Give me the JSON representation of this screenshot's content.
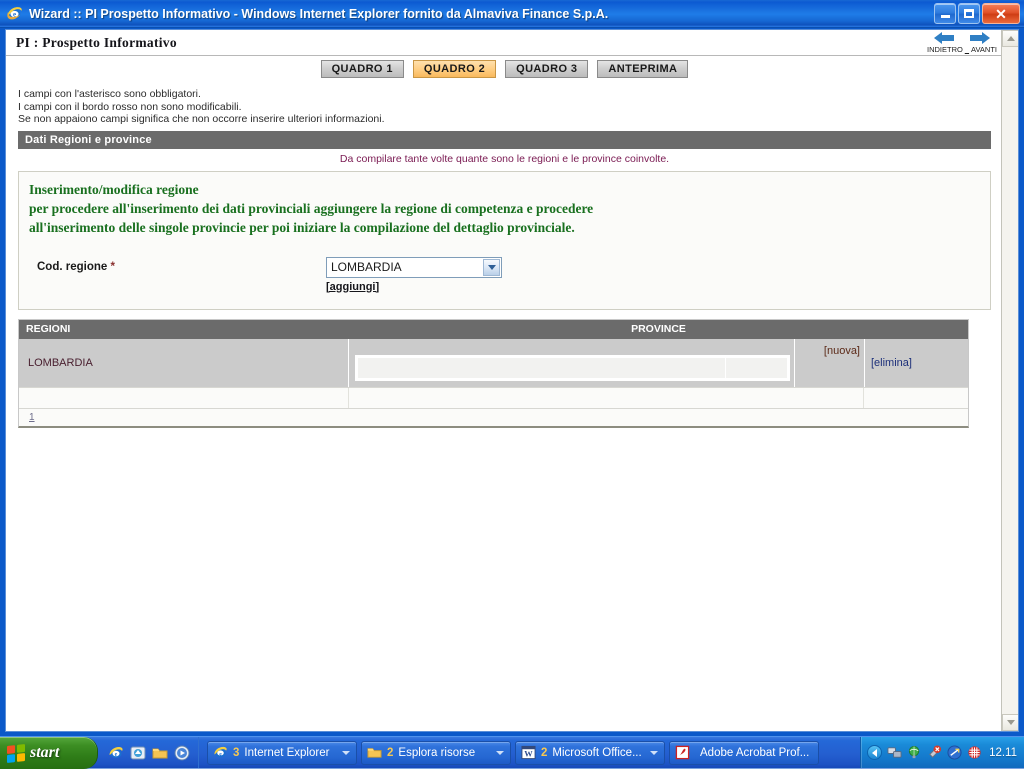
{
  "window": {
    "title": "Wizard :: PI Prospetto Informativo - Windows Internet Explorer fornito da Almaviva Finance S.p.A.",
    "icon": "ie-logo-icon",
    "minimize_label": "Minimize",
    "maximize_label": "Maximize",
    "close_label": "Close"
  },
  "page": {
    "title": "PI  :  Prospetto Informativo",
    "nav": {
      "back_label": "INDIETRO",
      "separator": "_",
      "forward_label": "AVANTI"
    },
    "tabs": [
      {
        "label": "QUADRO 1",
        "active": false
      },
      {
        "label": "QUADRO 2",
        "active": true
      },
      {
        "label": "QUADRO 3",
        "active": false
      },
      {
        "label": "ANTEPRIMA",
        "active": false
      }
    ],
    "notes": [
      "I campi con l'asterisco sono obbligatori.",
      "I campi con il bordo rosso non sono modificabili.",
      "Se non appaiono campi significa che non occorre inserire ulteriori informazioni."
    ],
    "section": {
      "bar_title": "Dati Regioni e province",
      "note": "Da compilare tante volte quante sono le regioni e le province coinvolte."
    },
    "panel": {
      "green_lines": [
        "Inserimento/modifica regione",
        "per procedere all'inserimento dei dati provinciali aggiungere la regione di competenza e procedere",
        "all'inserimento delle singole provincie per poi iniziare la compilazione del dettaglio provinciale."
      ],
      "field": {
        "label": "Cod. regione",
        "required_marker": "*",
        "select_value": "LOMBARDIA",
        "add_link": "[aggiungi]"
      }
    },
    "table": {
      "headers": [
        "REGIONI",
        "PROVINCE"
      ],
      "rows": [
        {
          "regione": "LOMBARDIA",
          "province_value": "",
          "nuova_link": "[nuova]",
          "elimina_link": "[elimina]"
        }
      ],
      "pager": "1"
    }
  },
  "colors": {
    "titlebar_blue": "#1b73e0",
    "tab_active": "#f9b95d",
    "tab_inactive": "#cfcfcf",
    "section_gray": "#6b6b6b",
    "green_text": "#19701f",
    "magenta_note": "#7a1a52",
    "row_gray": "#cbcbcb",
    "taskbar_blue": "#2468d8",
    "start_green": "#3d8f24"
  },
  "taskbar": {
    "start_label": "start",
    "quicklaunch": [
      "ie-icon",
      "msn-icon",
      "folder-icon",
      "media-player-icon"
    ],
    "tasks": [
      {
        "icon": "ie-icon",
        "count": "3",
        "label": "Internet Explorer",
        "has_caret": true
      },
      {
        "icon": "folder-icon",
        "count": "2",
        "label": "Esplora risorse",
        "has_caret": true
      },
      {
        "icon": "word-icon",
        "count": "2",
        "label": "Microsoft Office...",
        "has_caret": true
      },
      {
        "icon": "acrobat-icon",
        "count": "",
        "label": "Adobe Acrobat Prof...",
        "has_caret": false
      }
    ],
    "tray": {
      "icons": [
        "show-hidden-icons-chevron",
        "network-icon",
        "globe-icon",
        "antivirus-alert-icon",
        "shortcut-icon",
        "app-icon"
      ],
      "clock": "12.11"
    }
  }
}
